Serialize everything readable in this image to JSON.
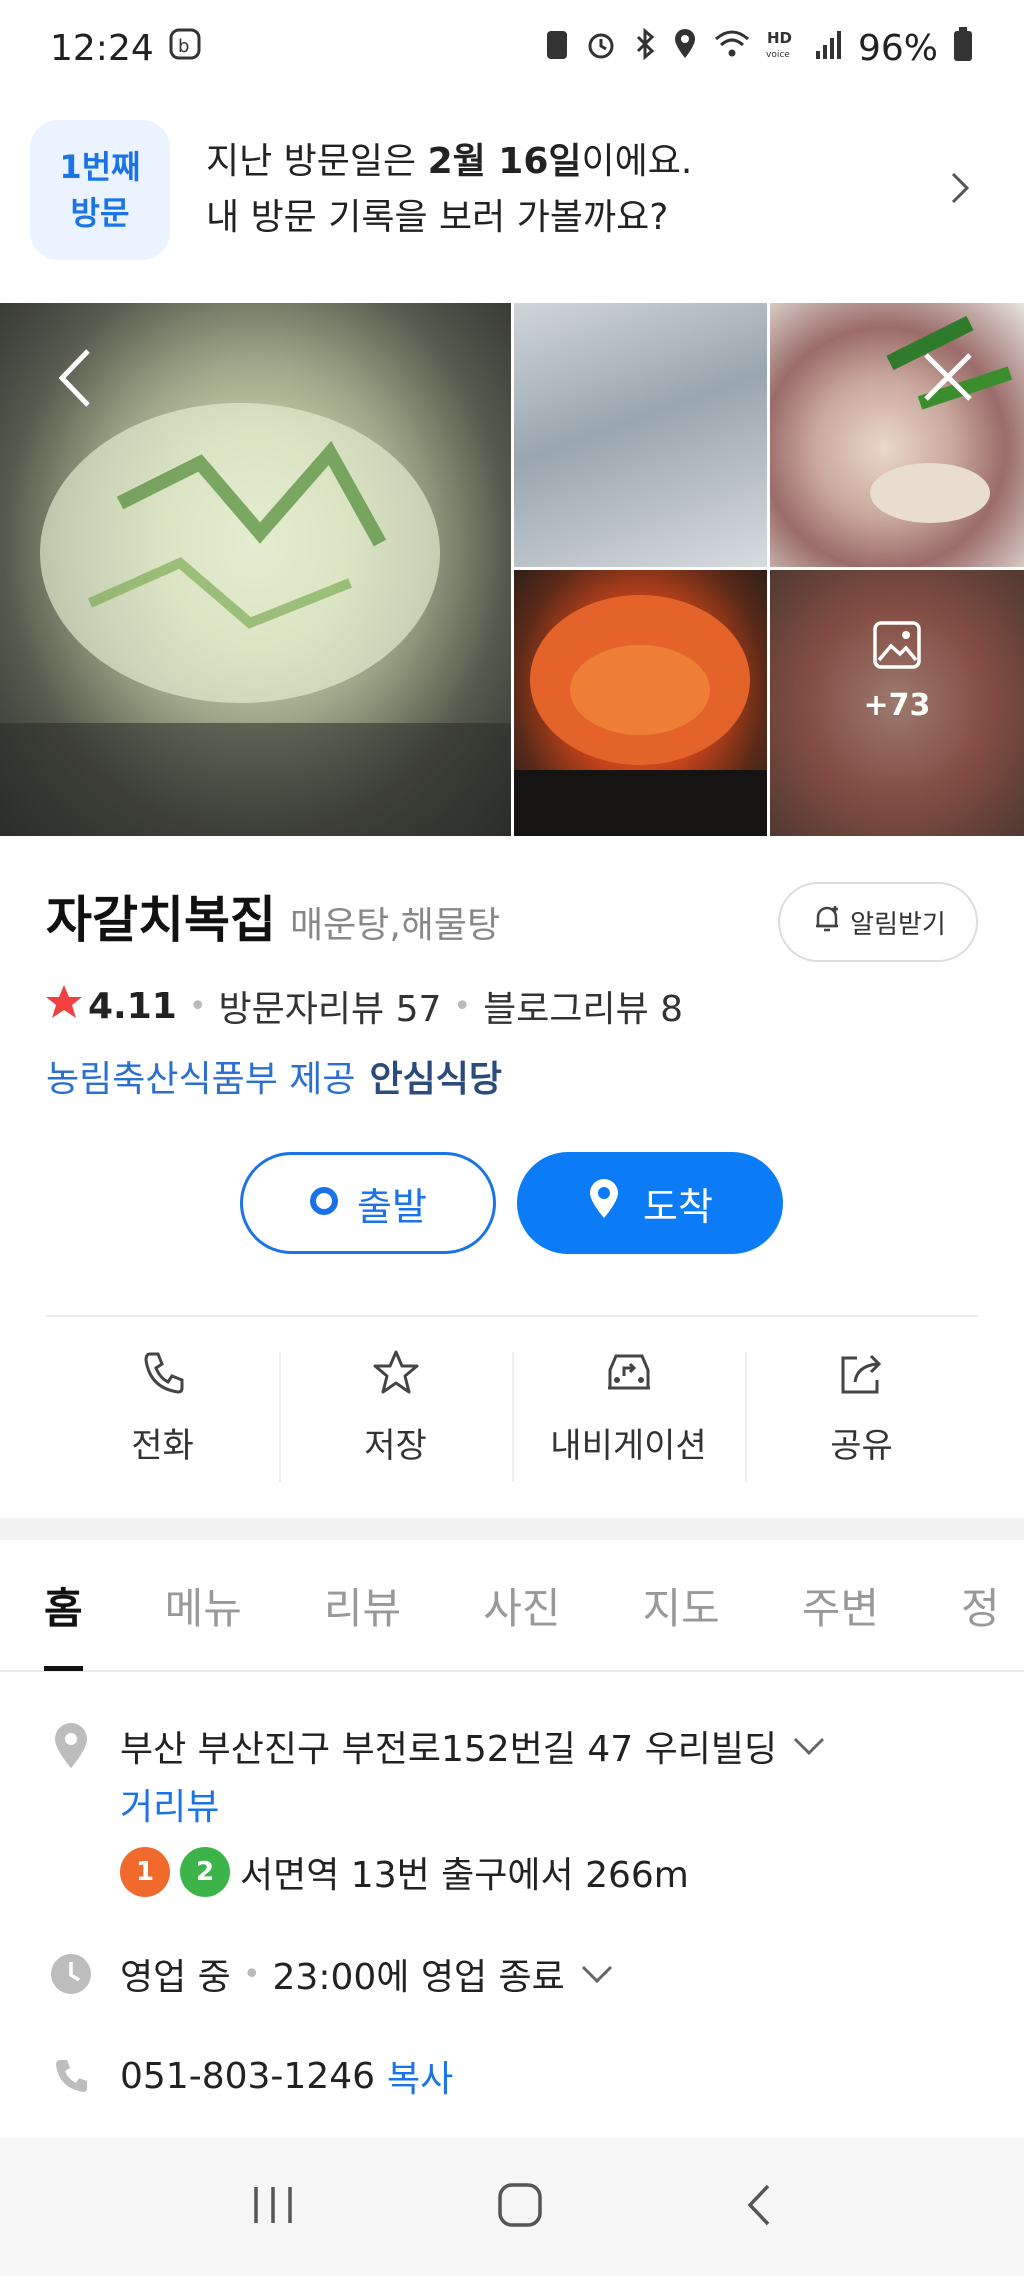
{
  "status_bar": {
    "time": "12:24",
    "battery": "96%"
  },
  "visit_banner": {
    "badge_line1": "1번째",
    "badge_line2": "방문",
    "line1_prefix": "지난 방문일은 ",
    "line1_date": "2월 16일",
    "line1_suffix": "이에요.",
    "line2": "내 방문 기록을 보러 가볼까요?"
  },
  "photos": {
    "more_count": "+73"
  },
  "place": {
    "name": "자갈치복집",
    "category": "매운탕,해물탕",
    "alarm_label": "알림받기",
    "rating": "4.11",
    "visitor_reviews": "방문자리뷰 57",
    "blog_reviews": "블로그리뷰 8",
    "safe_provider": "농림축산식품부 제공",
    "safe_label": "안심식당"
  },
  "route": {
    "start_label": "출발",
    "arrive_label": "도착"
  },
  "actions": [
    {
      "label": "전화",
      "icon": "phone-icon"
    },
    {
      "label": "저장",
      "icon": "star-icon"
    },
    {
      "label": "내비게이션",
      "icon": "car-navigation-icon"
    },
    {
      "label": "공유",
      "icon": "share-icon"
    }
  ],
  "tabs": [
    "홈",
    "메뉴",
    "리뷰",
    "사진",
    "지도",
    "주변",
    "정"
  ],
  "info": {
    "address": "부산 부산진구 부전로152번길 47 우리빌딩",
    "street_view": "거리뷰",
    "subway_line1": "1",
    "subway_line2": "2",
    "subway_text": "서면역 13번 출구에서 266m",
    "hours_status": "영업 중",
    "hours_detail": "23:00에 영업 종료",
    "phone": "051-803-1246",
    "copy_label": "복사"
  },
  "colors": {
    "accent": "#1a73e8",
    "star": "#f04040",
    "subway_line1": "#f06a2e",
    "subway_line2": "#3cb44a"
  }
}
